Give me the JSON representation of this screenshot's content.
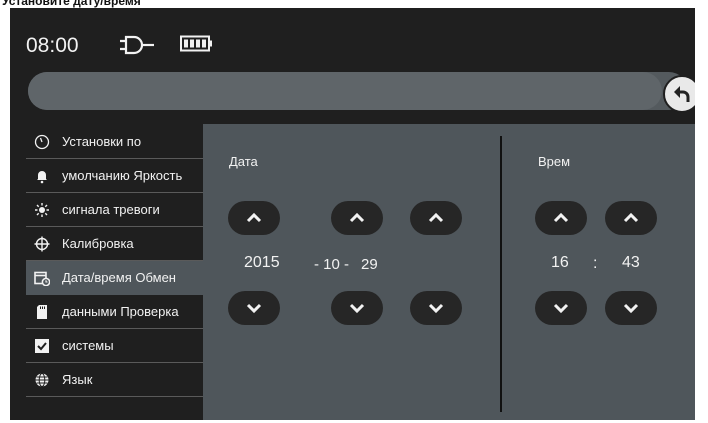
{
  "caption": "Установите дату/время",
  "status_bar": {
    "time": "08:00"
  },
  "progress": {
    "value": 0.96
  },
  "sidebar": {
    "items": [
      {
        "label": "Установки по",
        "icon": "gauge-icon"
      },
      {
        "label": "умолчанию Яркость",
        "icon": "bell-icon"
      },
      {
        "label": "сигнала тревоги",
        "icon": "sun-icon"
      },
      {
        "label": "Калибровка",
        "icon": "crosshair-icon"
      },
      {
        "label": "Дата/время Обмен",
        "icon": "calendar-clock-icon"
      },
      {
        "label": "данными Проверка",
        "icon": "sd-card-icon"
      },
      {
        "label": "системы",
        "icon": "checkbox-icon"
      },
      {
        "label": "Язык",
        "icon": "globe-icon"
      }
    ],
    "active_index": 4
  },
  "date_section": {
    "label": "Дата",
    "year": "2015",
    "month": "- 10 -",
    "day": "29"
  },
  "time_section": {
    "label": "Врем",
    "hour": "16",
    "separator": ":",
    "minute": "43"
  },
  "colors": {
    "background": "#1f1f1f",
    "panel": "#4f565b",
    "button": "#262626"
  }
}
